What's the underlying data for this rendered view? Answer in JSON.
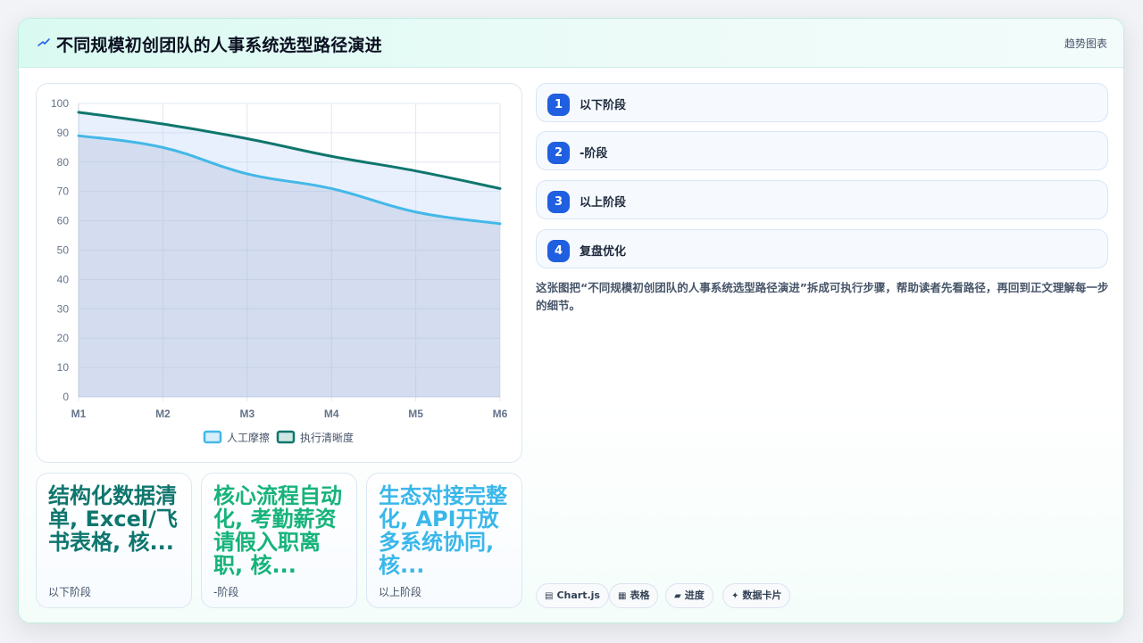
{
  "header": {
    "title": "不同规模初创团队的人事系统选型路径演进",
    "tag": "趋势图表"
  },
  "chart_data": {
    "type": "line",
    "categories": [
      "M1",
      "M2",
      "M3",
      "M4",
      "M5",
      "M6"
    ],
    "ylim": [
      0,
      100
    ],
    "yticks": [
      0,
      10,
      20,
      30,
      40,
      50,
      60,
      70,
      80,
      90,
      100
    ],
    "grid": true,
    "legend_position": "bottom",
    "series": [
      {
        "name": "人工摩擦",
        "values": [
          89,
          85,
          76,
          71,
          63,
          59
        ],
        "color": "#43b8e8",
        "fill": true
      },
      {
        "name": "执行清晰度",
        "values": [
          97,
          93,
          88,
          82,
          77,
          71
        ],
        "color": "#0f766e",
        "fill": true
      }
    ]
  },
  "stats": [
    {
      "value": "结构化数据清单, Excel/飞书表格, 核...",
      "label": "以下阶段",
      "color": "#0f766e"
    },
    {
      "value": "核心流程自动化, 考勤薪资请假入职离职, 核...",
      "label": "-阶段",
      "color": "#16b37a"
    },
    {
      "value": "生态对接完整化, API开放多系统协同, 核...",
      "label": "以上阶段",
      "color": "#3ab7ea"
    }
  ],
  "steps": [
    {
      "num": "1",
      "label": "以下阶段"
    },
    {
      "num": "2",
      "label": "-阶段"
    },
    {
      "num": "3",
      "label": "以上阶段"
    },
    {
      "num": "4",
      "label": "复盘优化"
    }
  ],
  "description": "这张图把“不同规模初创团队的人事系统选型路径演进”拆成可执行步骤，帮助读者先看路径，再回到正文理解每一步的细节。",
  "pills": [
    {
      "icon": "▤",
      "icon_name": "chart-icon",
      "label": "Chart.js"
    },
    {
      "icon": "▦",
      "icon_name": "table-icon",
      "label": "表格"
    },
    {
      "icon": "▰",
      "icon_name": "progress-icon",
      "label": "进度"
    },
    {
      "icon": "✦",
      "icon_name": "sparkle-icon",
      "label": "数据卡片"
    }
  ],
  "colors": {
    "accent": "#1f5fe0",
    "header_bg": "#d9faf1"
  }
}
